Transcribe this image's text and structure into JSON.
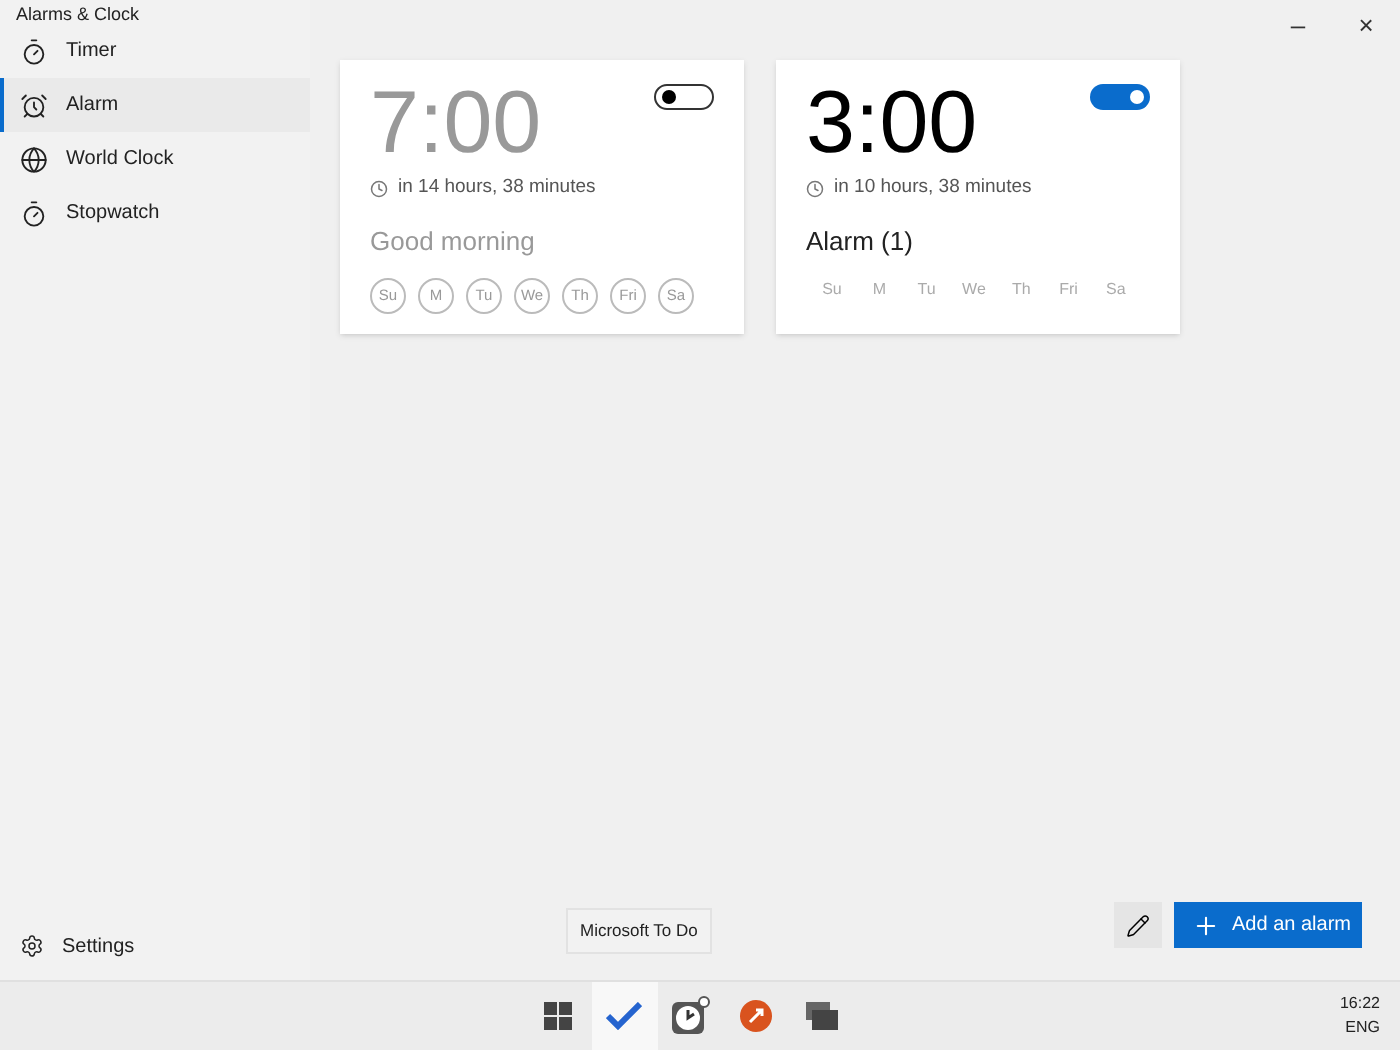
{
  "window": {
    "title": "Alarms & Clock",
    "controls": [
      "–",
      "×"
    ]
  },
  "nav": [
    {
      "label": "Timer",
      "kind": "timer",
      "selected": false
    },
    {
      "label": "Alarm",
      "kind": "alarm",
      "selected": true
    },
    {
      "label": "World Clock",
      "kind": "world",
      "selected": false
    },
    {
      "label": "Stopwatch",
      "kind": "stopwatch",
      "selected": false
    }
  ],
  "settings": {
    "label": "Settings"
  },
  "alarms": [
    {
      "time": "7:00",
      "remaining": "in 14 hours, 38 minutes",
      "name": "Good morning",
      "on": false,
      "days": [
        "Su",
        "M",
        "Tu",
        "We",
        "Th",
        "Fri",
        "Sa"
      ]
    },
    {
      "time": "3:00",
      "remaining": "in 10 hours, 38 minutes",
      "name": "Alarm (1)",
      "on": true,
      "days": [
        "Su",
        "M",
        "Tu",
        "We",
        "Th",
        "Fri",
        "Sa"
      ]
    }
  ],
  "add_button": {
    "label": "Add an alarm"
  },
  "tooltip": "Microsoft To Do",
  "taskbar": {
    "apps": [
      {
        "kind": "start",
        "selected": false
      },
      {
        "kind": "todo",
        "selected": true
      },
      {
        "kind": "clock",
        "selected": false
      },
      {
        "kind": "remote",
        "selected": false
      },
      {
        "kind": "stack",
        "selected": false
      }
    ],
    "clock": "16:22",
    "language": "ENG"
  }
}
